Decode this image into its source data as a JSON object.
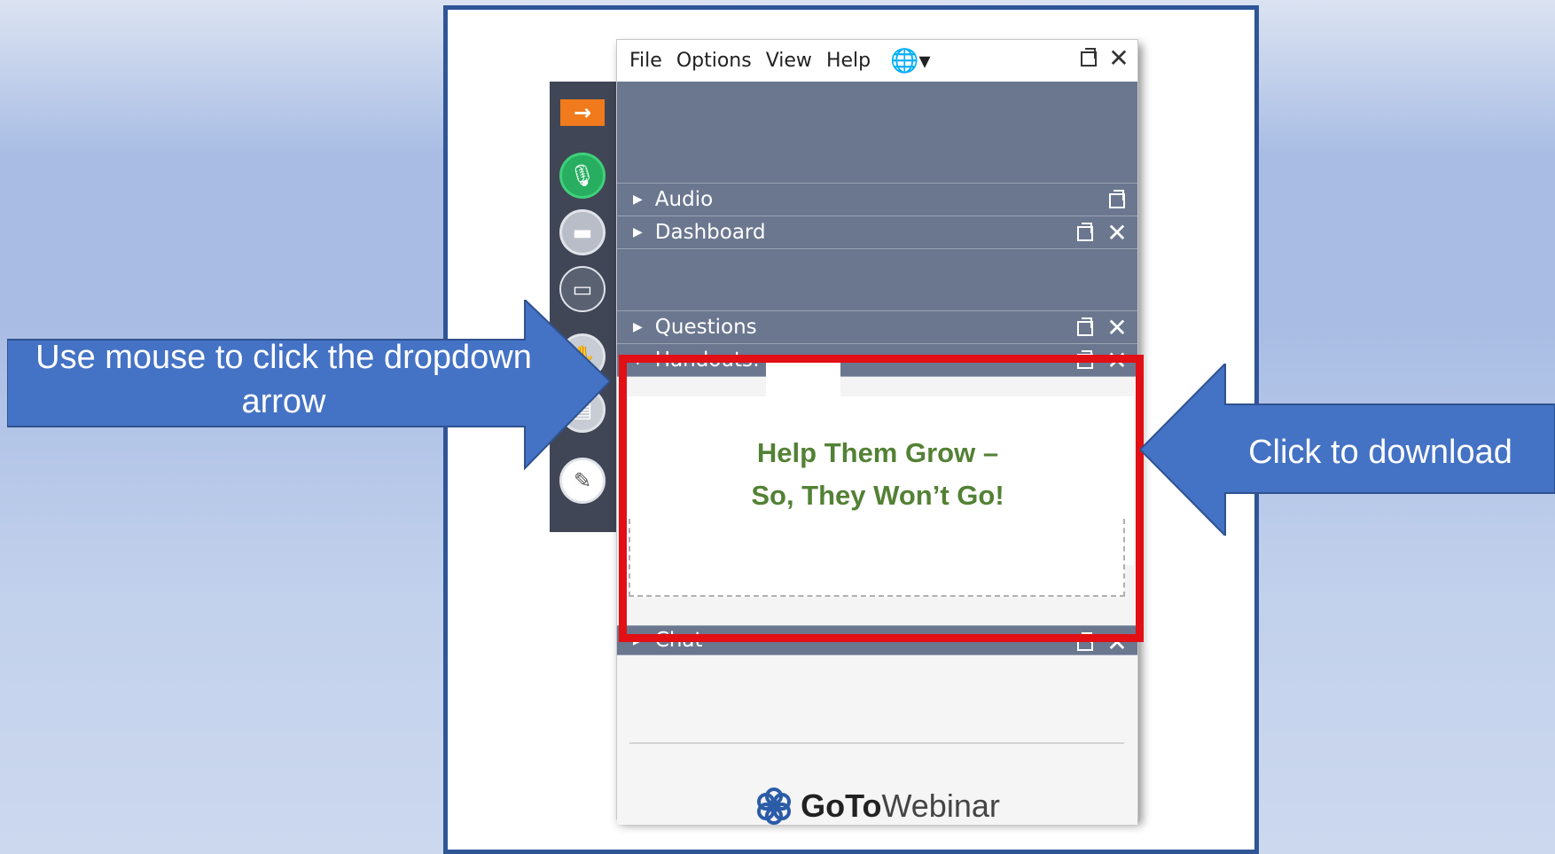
{
  "menu": {
    "file": "File",
    "options": "Options",
    "view": "View",
    "help": "Help",
    "language_icon": "globe-icon"
  },
  "panels": {
    "audio": "Audio",
    "dashboard": "Dashboard",
    "questions": "Questions",
    "handouts": "Handouts:",
    "chat": "Chat"
  },
  "handout": {
    "line1": "Help Them Grow –",
    "line2": "So, They Won’t Go!"
  },
  "brand": {
    "goto": "GoTo",
    "webinar": "Webinar"
  },
  "callouts": {
    "left": "Use mouse to click the dropdown arrow",
    "right": "Click to download"
  },
  "colors": {
    "callout": "#4472c4",
    "highlight": "#e20f14",
    "panel": "#6b778f",
    "handout_text": "#538135",
    "mic_active": "#27ae60"
  }
}
